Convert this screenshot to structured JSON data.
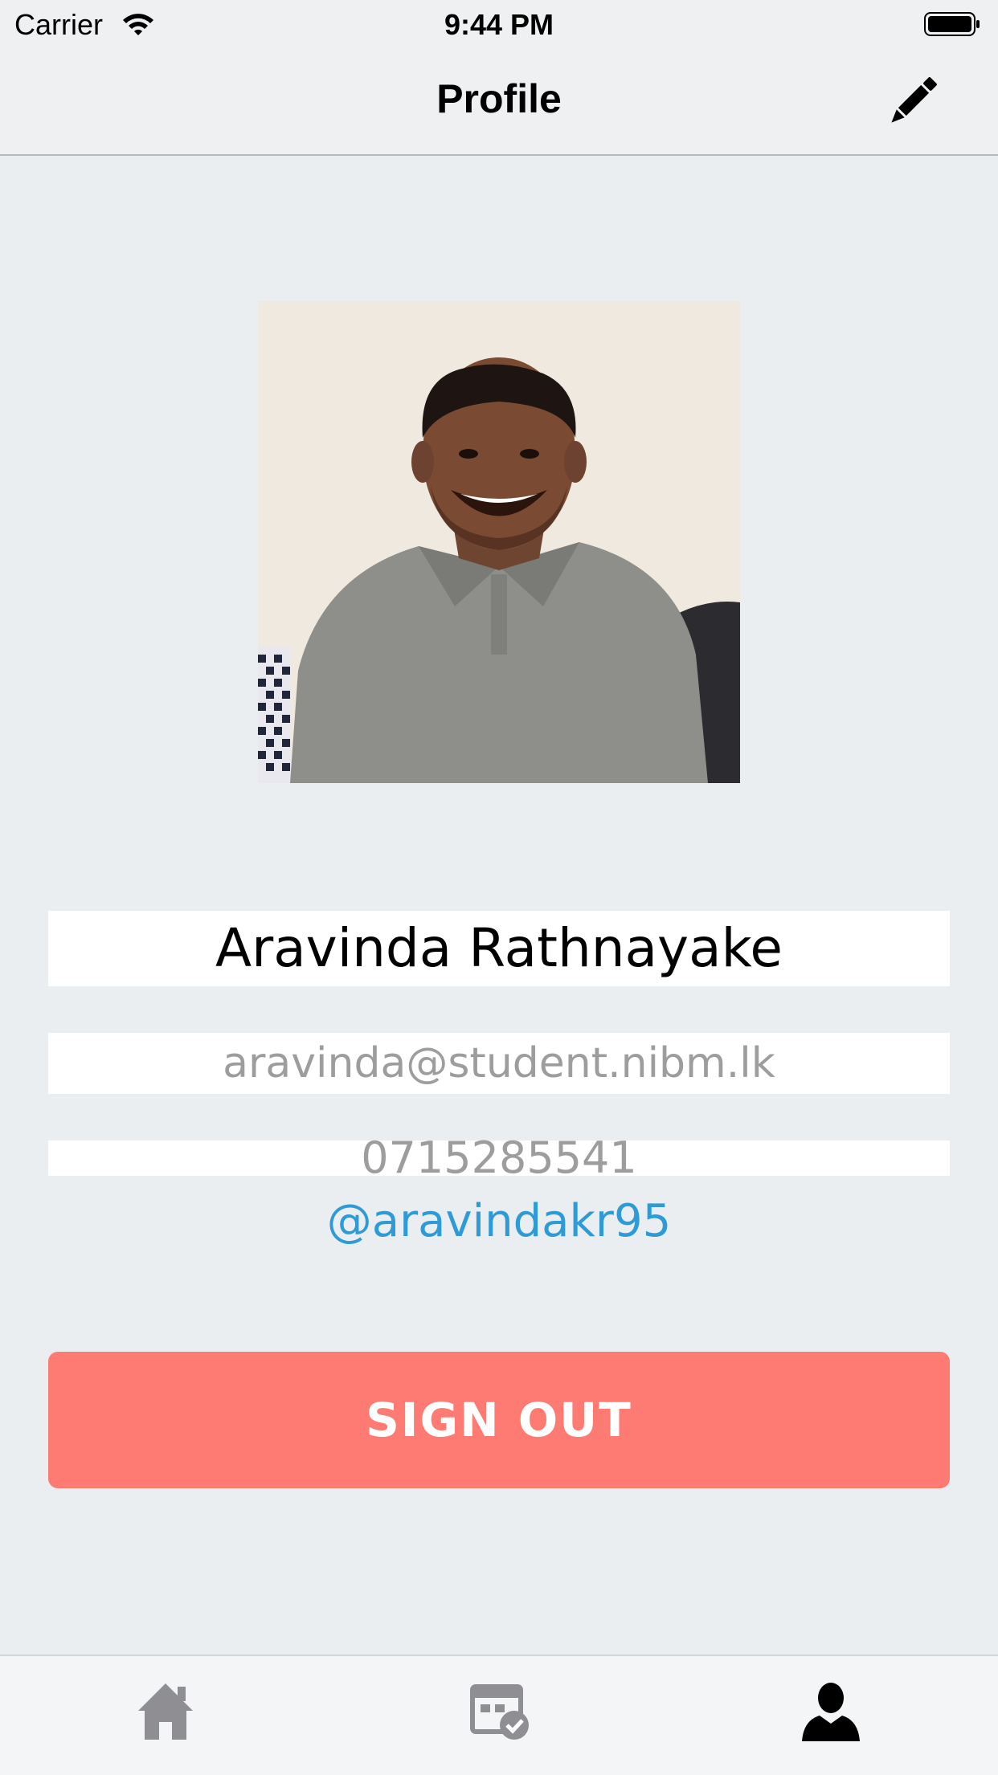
{
  "status_bar": {
    "carrier": "Carrier",
    "time": "9:44 PM",
    "wifi_icon": "wifi-icon",
    "battery_icon": "battery-icon"
  },
  "nav": {
    "title": "Profile",
    "edit_icon": "pencil-icon"
  },
  "profile": {
    "photo": "profile-photo",
    "name": "Aravinda Rathnayake",
    "email": "aravinda@student.nibm.lk",
    "phone": "0715285541",
    "twitter": "@aravindakr95"
  },
  "actions": {
    "sign_out_label": "SIGN OUT"
  },
  "tab_bar": {
    "items": [
      {
        "icon": "home-icon",
        "selected": false
      },
      {
        "icon": "event-check-icon",
        "selected": false
      },
      {
        "icon": "person-icon",
        "selected": true
      }
    ]
  },
  "colors": {
    "background": "#ebeef0",
    "sign_out": "#fe7b74",
    "twitter_link": "#2e9bd6",
    "muted_text": "#9d9d9d",
    "tab_inactive": "#8e8e93",
    "tab_active": "#000000"
  }
}
